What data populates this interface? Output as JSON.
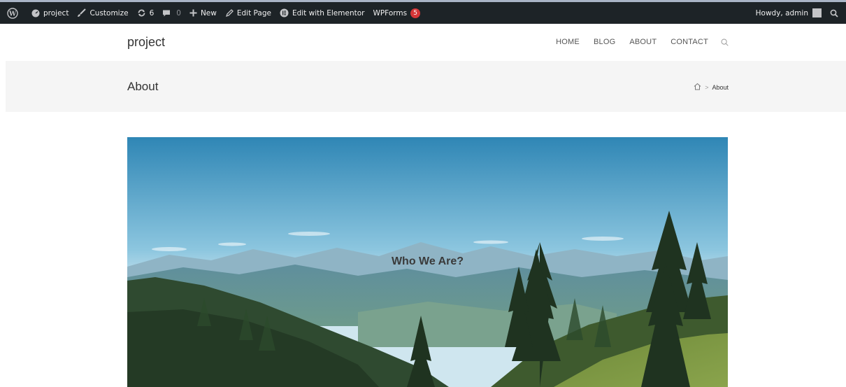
{
  "admin_bar": {
    "site_name": "project",
    "customize": "Customize",
    "updates_count": "6",
    "comments_count": "0",
    "new": "New",
    "edit_page": "Edit Page",
    "elementor": "Edit with Elementor",
    "wpforms": "WPForms",
    "wpforms_badge": "5",
    "greeting": "Howdy, admin"
  },
  "header": {
    "site_title": "project",
    "nav": [
      "HOME",
      "BLOG",
      "ABOUT",
      "CONTACT"
    ]
  },
  "title_bar": {
    "title": "About",
    "breadcrumb_sep": ">",
    "breadcrumb_current": "About"
  },
  "hero": {
    "heading": "Who We Are?"
  },
  "colors": {
    "admin_bar_bg": "#1d2327",
    "badge": "#d63638",
    "title_bar_bg": "#f5f5f5"
  }
}
